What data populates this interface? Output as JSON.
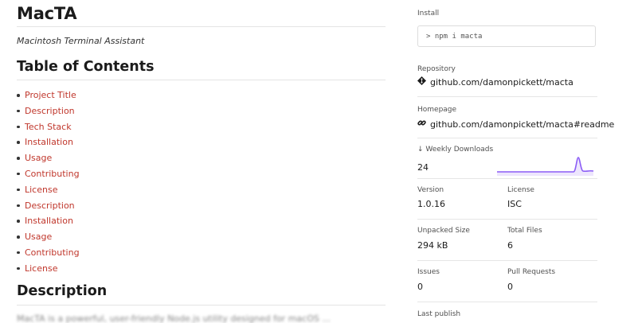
{
  "readme": {
    "title": "MacTA",
    "tagline": "Macintosh Terminal Assistant",
    "toc_heading": "Table of Contents",
    "toc": [
      "Project Title",
      "Description",
      "Tech Stack",
      "Installation",
      "Usage",
      "Contributing",
      "License",
      "Description",
      "Installation",
      "Usage",
      "Contributing",
      "License"
    ],
    "description_heading": "Description",
    "description_fragment": "MacTA is a powerful, user-friendly Node.js utility designed for macOS ..."
  },
  "sidebar": {
    "install": {
      "label": "Install",
      "command": "> npm i macta"
    },
    "repository": {
      "label": "Repository",
      "link": "github.com/damonpickett/macta",
      "icon": "git-diamond-icon"
    },
    "homepage": {
      "label": "Homepage",
      "link": "github.com/damonpickett/macta#readme",
      "icon": "link-icon"
    },
    "downloads": {
      "label": "↓ Weekly Downloads",
      "value": "24",
      "line_color": "#8b5cf6",
      "fill_color": "#ede6fd"
    },
    "version": {
      "label": "Version",
      "value": "1.0.16"
    },
    "license": {
      "label": "License",
      "value": "ISC"
    },
    "unpacked_size": {
      "label": "Unpacked Size",
      "value": "294 kB"
    },
    "total_files": {
      "label": "Total Files",
      "value": "6"
    },
    "issues": {
      "label": "Issues",
      "value": "0"
    },
    "pull_requests": {
      "label": "Pull Requests",
      "value": "0"
    },
    "last_publish": {
      "label": "Last publish"
    }
  }
}
